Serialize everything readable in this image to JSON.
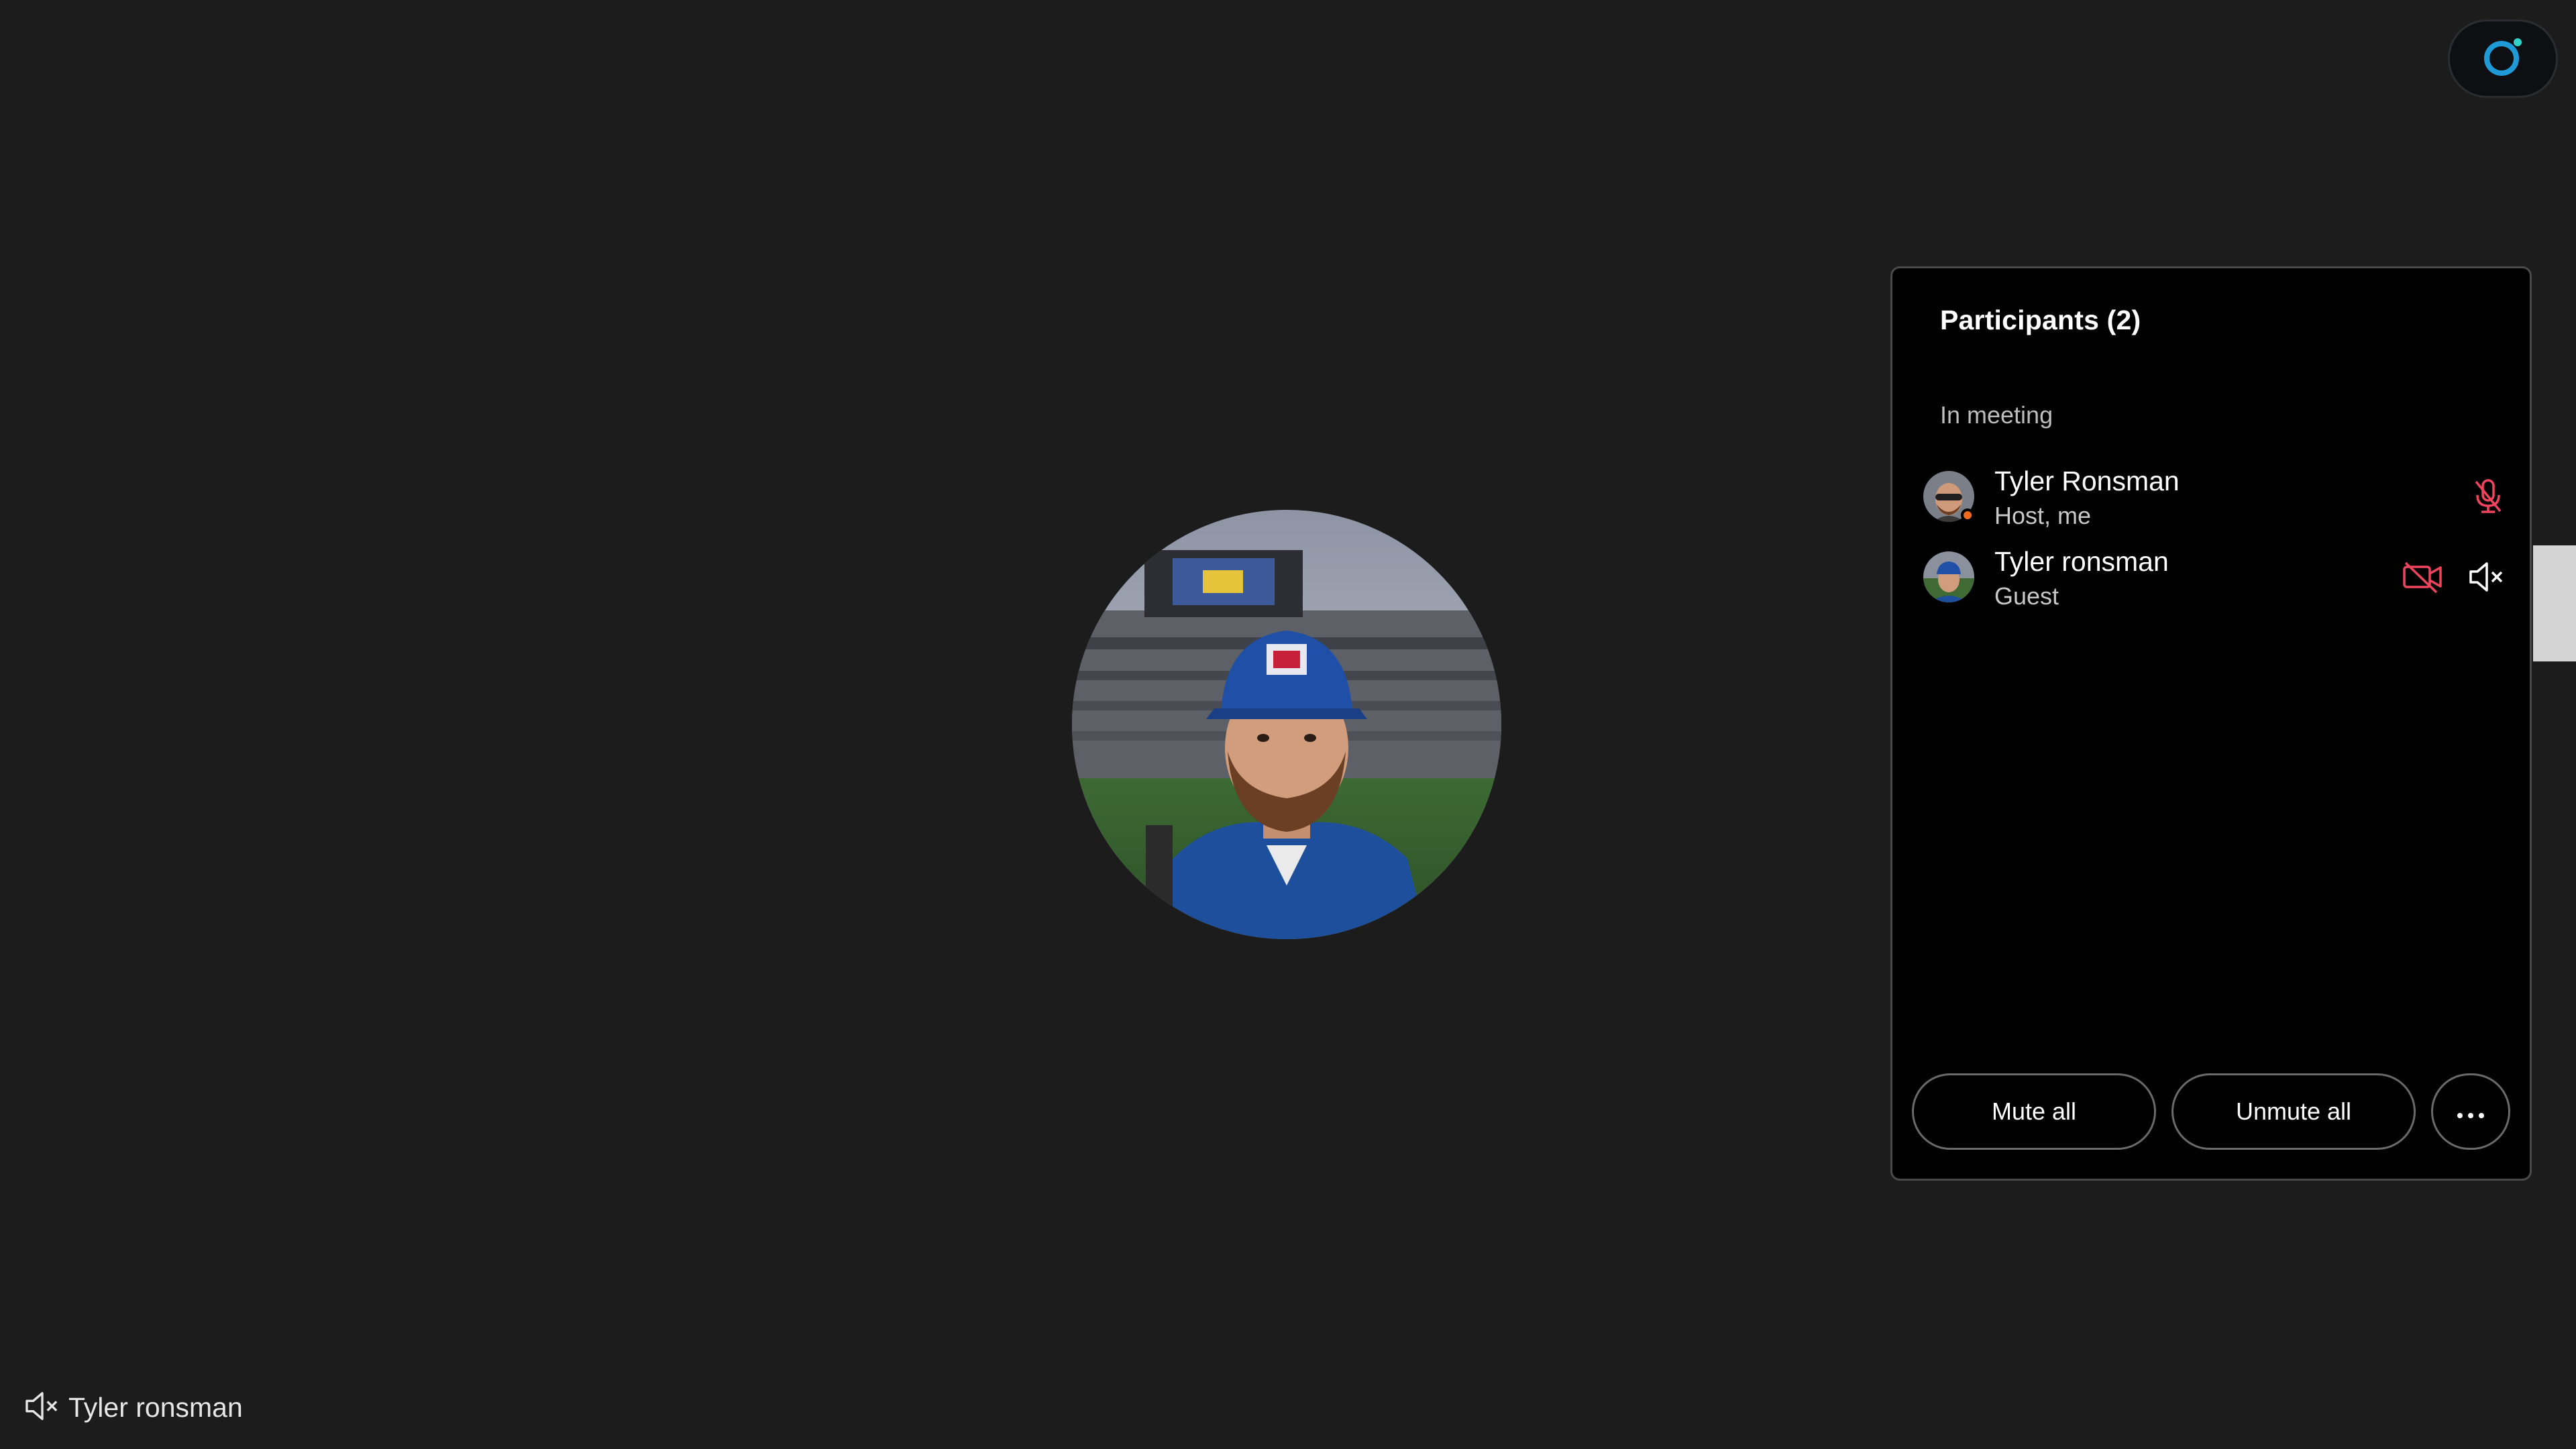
{
  "colors": {
    "background": "#1c1c1c",
    "panel": "#000000",
    "muted_red": "#f0445e",
    "presence_orange": "#f26b1d",
    "brand_blue": "#1e9bd7"
  },
  "app_button": {
    "icon": "webex-icon"
  },
  "participants_panel": {
    "title": "Participants (2)",
    "section_label": "In meeting",
    "participants": [
      {
        "name": "Tyler Ronsman",
        "role": "Host, me",
        "presence": "active",
        "icons": [
          "mic-muted-icon"
        ]
      },
      {
        "name": "Tyler ronsman",
        "role": "Guest",
        "icons": [
          "video-off-icon",
          "speaker-muted-icon"
        ]
      }
    ],
    "buttons": {
      "mute_all": "Mute all",
      "unmute_all": "Unmute all",
      "more": "···"
    }
  },
  "stage": {
    "speaker_name": "Tyler ronsman",
    "speaker_icon": "speaker-muted-icon"
  }
}
